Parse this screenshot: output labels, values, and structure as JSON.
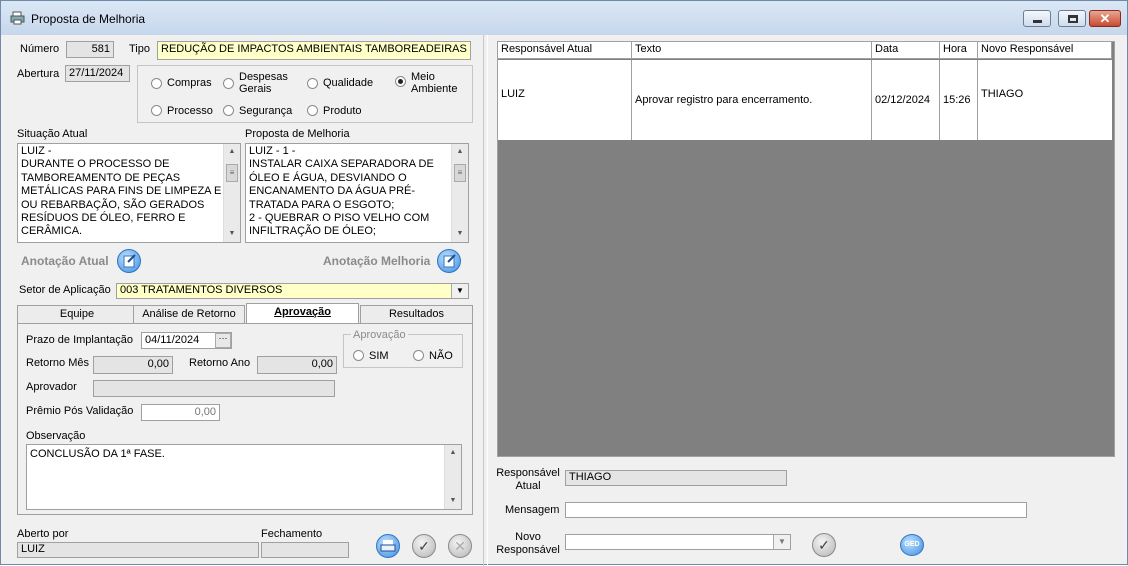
{
  "window": {
    "title": "Proposta de Melhoria",
    "icon": "printer-icon"
  },
  "header": {
    "numero_label": "Número",
    "numero_value": "581",
    "tipo_label": "Tipo",
    "tipo_value": "REDUÇÃO DE IMPACTOS AMBIENTAIS TAMBOREADEIRAS",
    "abertura_label": "Abertura",
    "abertura_value": "27/11/2024"
  },
  "categories": [
    {
      "label": "Compras",
      "checked": false
    },
    {
      "label": "Despesas Gerais",
      "checked": false
    },
    {
      "label": "Qualidade",
      "checked": false
    },
    {
      "label": "Meio Ambiente",
      "checked": true
    },
    {
      "label": "Processo",
      "checked": false
    },
    {
      "label": "Segurança",
      "checked": false
    },
    {
      "label": "Produto",
      "checked": false
    }
  ],
  "situacao": {
    "label": "Situação Atual",
    "text": "LUIZ                             -\nDURANTE O PROCESSO DE\nTAMBOREAMENTO DE PEÇAS\nMETÁLICAS PARA FINS DE LIMPEZA E\nOU REBARBAÇÃO, SÃO GERADOS\nRESÍDUOS DE ÓLEO, FERRO E\nCERÂMICA."
  },
  "proposta": {
    "label": "Proposta de Melhoria",
    "text": "LUIZ                          - 1 -\nINSTALAR CAIXA SEPARADORA DE\nÓLEO E ÁGUA, DESVIANDO O\nENCANAMENTO DA ÁGUA PRÉ-\nTRATADA PARA O ESGOTO;\n2 - QUEBRAR O PISO VELHO COM\nINFILTRAÇÃO DE ÓLEO;"
  },
  "anotacao": {
    "atual": "Anotação Atual",
    "melhoria": "Anotação Melhoria"
  },
  "setor": {
    "label": "Setor de Aplicação",
    "value": "003 TRATAMENTOS DIVERSOS"
  },
  "tabs": [
    {
      "label": "Equipe"
    },
    {
      "label": "Análise de Retorno"
    },
    {
      "label": "Aprovação"
    },
    {
      "label": "Resultados"
    }
  ],
  "aprovacao": {
    "prazo_label": "Prazo de Implantação",
    "prazo_value": "04/11/2024",
    "retorno_mes_label": "Retorno Mês",
    "retorno_mes_value": "0,00",
    "retorno_ano_label": "Retorno Ano",
    "retorno_ano_value": "0,00",
    "aprovador_label": "Aprovador",
    "aprovador_value": "",
    "premio_label": "Prêmio Pós Validação",
    "premio_value": "0,00",
    "group_label": "Aprovação",
    "sim": "SIM",
    "nao": "NÃO",
    "observacao_label": "Observação",
    "observacao_value": "CONCLUSÃO DA 1ª FASE."
  },
  "footer": {
    "aberto_label": "Aberto por",
    "aberto_value": "LUIZ",
    "fechamento_label": "Fechamento",
    "fechamento_value": ""
  },
  "grid": {
    "columns": [
      "Responsável Atual",
      "Texto",
      "Data",
      "Hora",
      "Novo Responsável"
    ],
    "rows": [
      {
        "responsavel": "LUIZ",
        "texto": "Aprovar registro para encerramento.",
        "data": "02/12/2024",
        "hora": "15:26",
        "novo": "THIAGO"
      }
    ]
  },
  "right": {
    "resp_label": "Responsável Atual",
    "resp_value": "THIAGO",
    "mensagem_label": "Mensagem",
    "mensagem_value": "",
    "novo_label": "Novo Responsável",
    "novo_value": "",
    "ged_label": "GED"
  }
}
